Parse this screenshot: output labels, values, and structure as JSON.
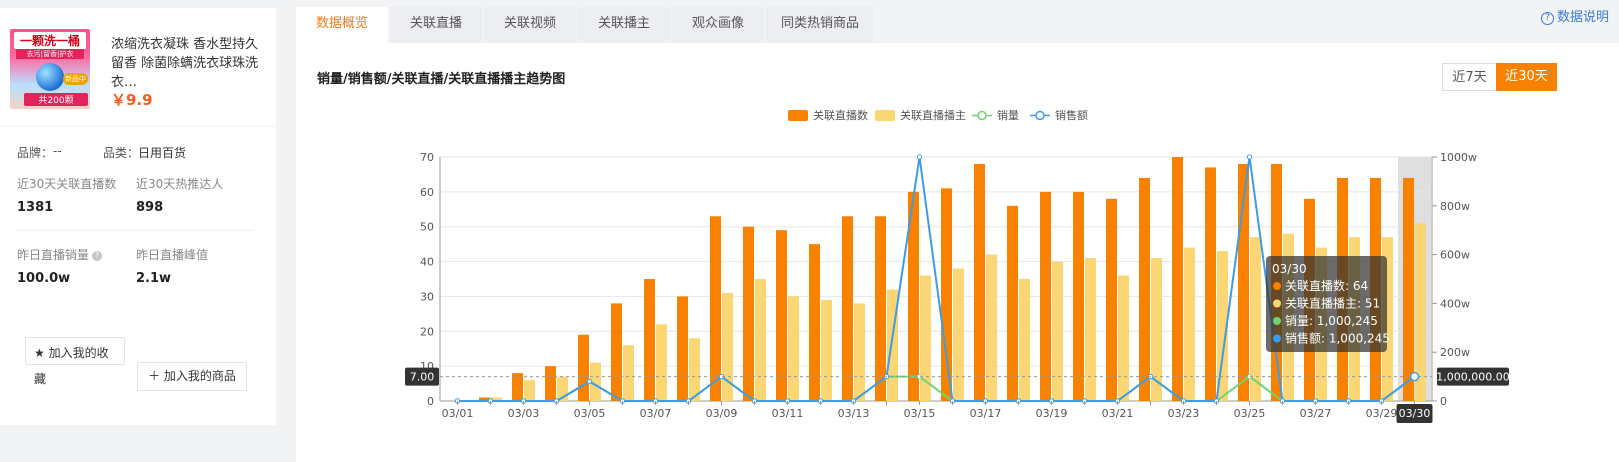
{
  "product": {
    "thumb_text_top": "一颗洗一桶",
    "thumb_text_sub": "去污|留香|护衣",
    "thumb_badge": "新品中",
    "thumb_text_bottom": "共200颗",
    "title": "浓缩洗衣凝珠 香水型持久留香 除菌除螨洗衣球珠洗衣…",
    "price": "￥9.9"
  },
  "stats": {
    "brand_label": "品牌：",
    "brand_value": "--",
    "category_label": "品类：",
    "category_value": "日用百货",
    "live_count_label": "近30天关联直播数",
    "live_count_value": "1381",
    "hot_talent_label": "近30天热推达人",
    "hot_talent_value": "898",
    "yesterday_sales_label": "昨日直播销量",
    "yesterday_sales_value": "100.0w",
    "yesterday_peak_label": "昨日直播峰值",
    "yesterday_peak_value": "2.1w"
  },
  "actions": {
    "fav_line1": "加入我的收",
    "fav_line2": "藏",
    "add_goods": "加入我的商品"
  },
  "tabs": [
    "数据概览",
    "关联直播",
    "关联视频",
    "关联播主",
    "观众画像",
    "同类热销商品"
  ],
  "help_label": "数据说明",
  "chart_title": "销量/销售额/关联直播/关联直播播主趋势图",
  "ranges": {
    "r7": "近7天",
    "r30": "近30天"
  },
  "colors": {
    "accent": "#f88200",
    "bar_live": "#f88200",
    "bar_anchor": "#fad675",
    "line_sales": "#6fd473",
    "line_revenue": "#3d9be9",
    "tab_active": "#f47a10"
  },
  "chart_data": {
    "type": "bar",
    "categories": [
      "03/01",
      "03/02",
      "03/03",
      "03/04",
      "03/05",
      "03/06",
      "03/07",
      "03/08",
      "03/09",
      "03/10",
      "03/11",
      "03/12",
      "03/13",
      "03/14",
      "03/15",
      "03/16",
      "03/17",
      "03/18",
      "03/19",
      "03/20",
      "03/21",
      "03/22",
      "03/23",
      "03/24",
      "03/25",
      "03/26",
      "03/27",
      "03/28",
      "03/29",
      "03/30"
    ],
    "x_tick_labels": [
      "03/01",
      "03/03",
      "03/05",
      "03/07",
      "03/09",
      "03/11",
      "03/13",
      "03/15",
      "03/17",
      "03/19",
      "03/21",
      "03/23",
      "03/25",
      "03/27",
      "03/29"
    ],
    "series": [
      {
        "name": "关联直播数",
        "axis": "left",
        "kind": "bar",
        "values": [
          0,
          1,
          8,
          10,
          19,
          28,
          35,
          30,
          53,
          50,
          49,
          45,
          53,
          53,
          60,
          61,
          68,
          56,
          60,
          60,
          58,
          64,
          70,
          67,
          68,
          68,
          58,
          64,
          64,
          64
        ]
      },
      {
        "name": "关联直播播主",
        "axis": "left",
        "kind": "bar",
        "values": [
          0,
          1,
          6,
          7,
          11,
          16,
          22,
          18,
          31,
          35,
          30,
          29,
          28,
          32,
          36,
          38,
          42,
          35,
          40,
          41,
          36,
          41,
          44,
          43,
          47,
          48,
          44,
          47,
          47,
          51
        ]
      },
      {
        "name": "销量",
        "axis": "right",
        "kind": "line",
        "unit": "w",
        "values": [
          0,
          0,
          0,
          0,
          80,
          0,
          0,
          0,
          100,
          0,
          0,
          0,
          0,
          100,
          100,
          0,
          0,
          0,
          0,
          0,
          0,
          100,
          0,
          0,
          100,
          0,
          0,
          0,
          0,
          100
        ]
      },
      {
        "name": "销售额",
        "axis": "right",
        "kind": "line",
        "unit": "w",
        "values": [
          0,
          0,
          0,
          0,
          80,
          0,
          0,
          0,
          100,
          0,
          0,
          0,
          0,
          100,
          1000,
          0,
          0,
          0,
          0,
          0,
          0,
          100,
          0,
          0,
          1000,
          0,
          0,
          0,
          0,
          100
        ]
      }
    ],
    "yleft": {
      "min": 0,
      "max": 70,
      "ticks": [
        "0",
        "10",
        "20",
        "30",
        "40",
        "50",
        "60",
        "70"
      ]
    },
    "yright": {
      "min": 0,
      "max": 1000,
      "ticks": [
        "0",
        "200w",
        "400w",
        "600w",
        "800w",
        "1000w"
      ]
    },
    "legend_position": "top-center",
    "grid": true,
    "crosshair": {
      "left_label": "7.00",
      "right_label": "1,000,000.00",
      "x_label": "03/30"
    },
    "tooltip": {
      "title": "03/30",
      "rows": [
        {
          "label": "关联直播数: 64",
          "color": "#f88200"
        },
        {
          "label": "关联直播播主: 51",
          "color": "#fad675"
        },
        {
          "label": "销量: 1,000,245",
          "color": "#6fd473"
        },
        {
          "label": "销售额: 1,000,245",
          "color": "#3d9be9"
        }
      ]
    }
  }
}
